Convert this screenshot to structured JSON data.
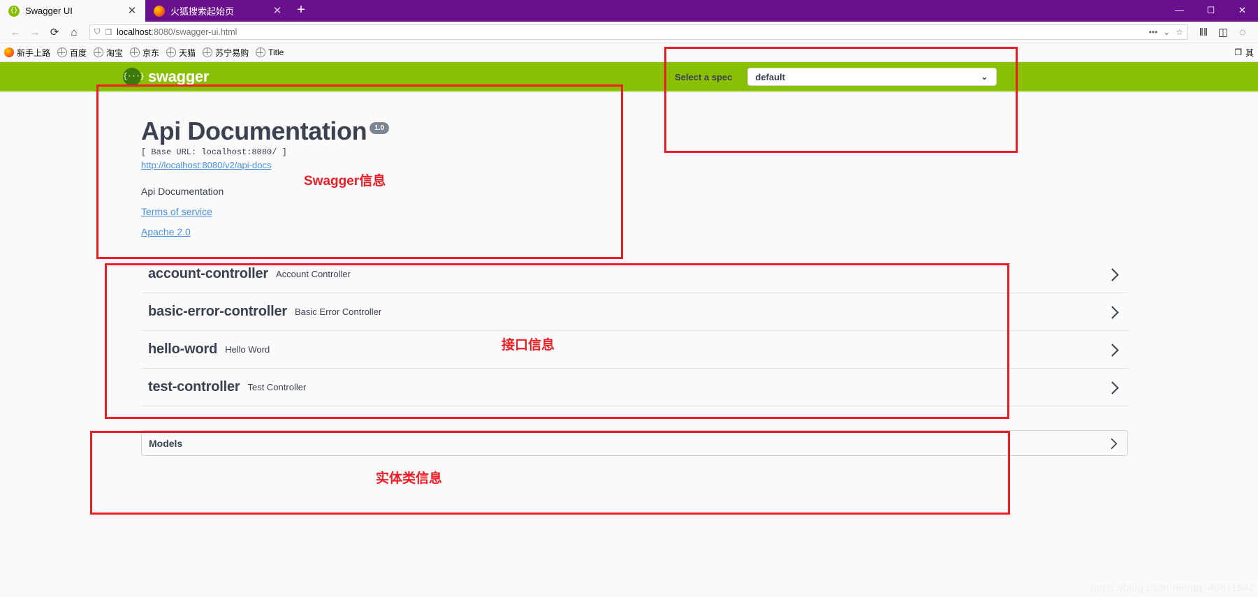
{
  "browser": {
    "tabs": [
      {
        "title": "Swagger UI",
        "icon": "swagger-favicon",
        "active": true,
        "close_label": "✕"
      },
      {
        "title": "火狐搜索起始页",
        "icon": "firefox-favicon",
        "active": false,
        "close_label": "✕"
      }
    ],
    "new_tab_label": "+",
    "window_controls": {
      "minimize": "—",
      "maximize": "☐",
      "close": "✕"
    },
    "nav": {
      "back": "←",
      "forward": "→",
      "reload": "⟳",
      "home": "⌂",
      "shield_icon": "⛉",
      "page_icon": "❐",
      "url_prefix": "localhost",
      "url_suffix": ":8080/swagger-ui.html",
      "url_full": "localhost:8080/swagger-ui.html",
      "more_icon": "•••",
      "pocket_icon": "⌄",
      "bookmark_star_icon": "☆",
      "library_icon": "‖‖",
      "sidebar_icon": "◫",
      "account_icon": "◌"
    },
    "bookmarks": [
      {
        "label": "新手上路",
        "icon": "firefox-icon"
      },
      {
        "label": "百度",
        "icon": "globe-icon"
      },
      {
        "label": "淘宝",
        "icon": "globe-icon"
      },
      {
        "label": "京东",
        "icon": "globe-icon"
      },
      {
        "label": "天猫",
        "icon": "globe-icon"
      },
      {
        "label": "苏宁易购",
        "icon": "globe-icon"
      },
      {
        "label": "Title",
        "icon": "globe-icon"
      }
    ],
    "bookmarks_right": {
      "folder_icon": "❐",
      "overflow_label": "其"
    }
  },
  "swagger": {
    "logo_mark": "{···}",
    "logo_text": "swagger",
    "spec": {
      "label": "Select a spec",
      "selected": "default",
      "options": [
        "default"
      ],
      "caret_icon": "⌄"
    },
    "info": {
      "title": "Api Documentation",
      "version_badge": "1.0",
      "base_url": "[ Base URL: localhost:8080/ ]",
      "api_docs_link": "http://localhost:8080/v2/api-docs",
      "description": "Api Documentation",
      "terms_link": "Terms of service",
      "license_link": "Apache 2.0"
    },
    "tags": [
      {
        "name": "account-controller",
        "description": "Account Controller",
        "expand_icon": "chevron-right-icon"
      },
      {
        "name": "basic-error-controller",
        "description": "Basic Error Controller",
        "expand_icon": "chevron-right-icon"
      },
      {
        "name": "hello-word",
        "description": "Hello Word",
        "expand_icon": "chevron-right-icon"
      },
      {
        "name": "test-controller",
        "description": "Test Controller",
        "expand_icon": "chevron-right-icon"
      }
    ],
    "models": {
      "label": "Models",
      "expand_icon": "chevron-right-icon"
    }
  },
  "annotations": {
    "color": "#ee1c25",
    "swagger_info": "Swagger信息",
    "api_info": "接口信息",
    "model_info": "实体类信息"
  },
  "watermark": "https://blog.csdn.net/qq_40811542"
}
